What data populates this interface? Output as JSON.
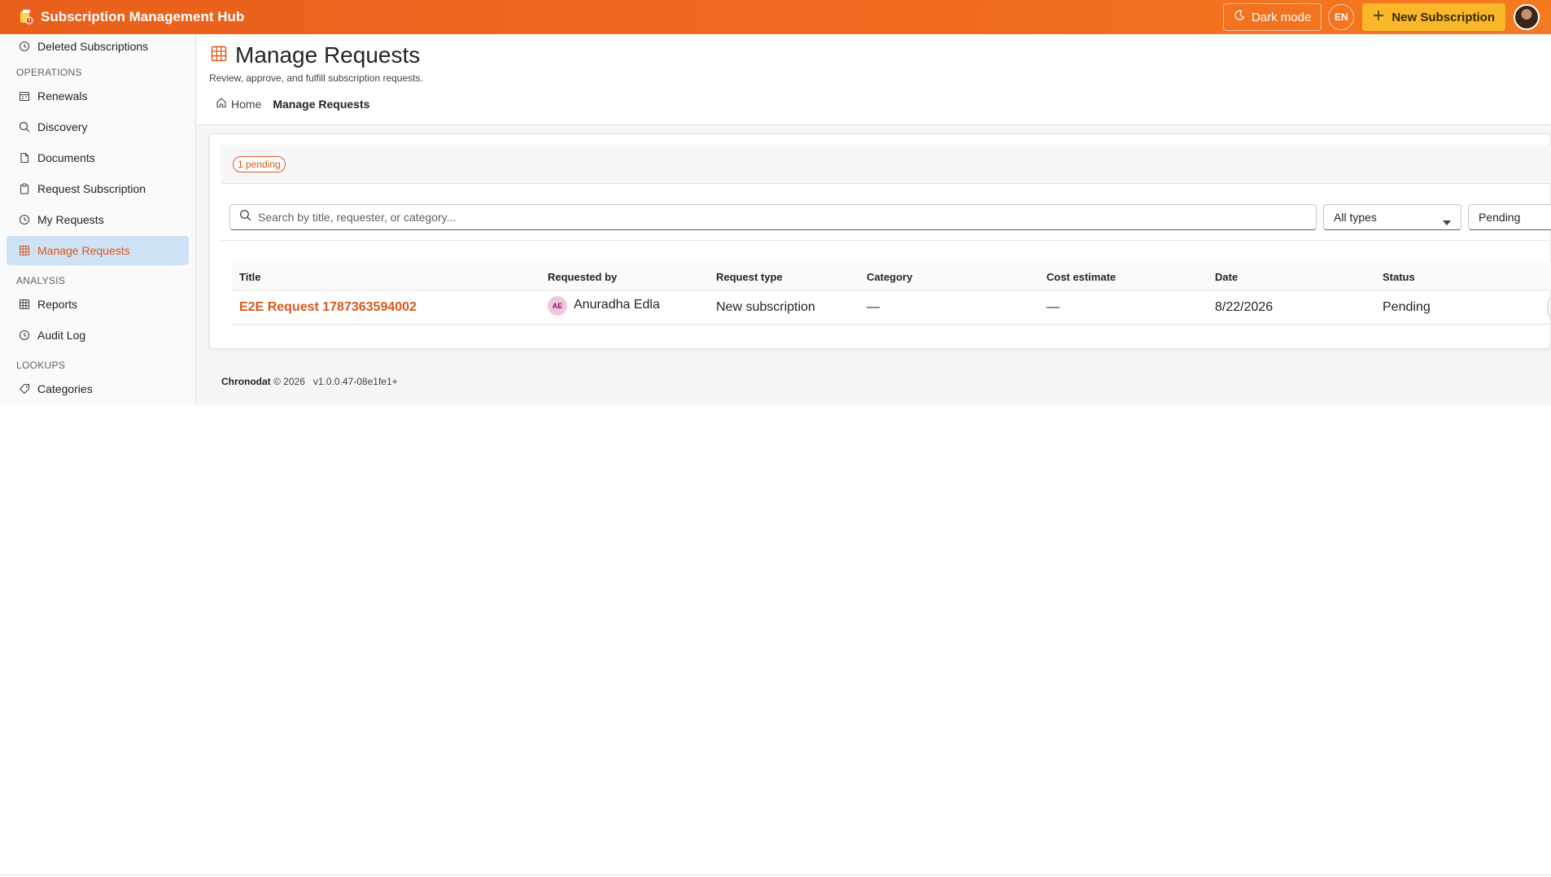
{
  "app": {
    "title": "Subscription Management Hub"
  },
  "topbar": {
    "dark_mode_label": "Dark mode",
    "language": "EN",
    "new_subscription_label": "New Subscription"
  },
  "sidebar": {
    "items_top": [
      {
        "label": "Deleted Subscriptions",
        "icon": "history-icon"
      }
    ],
    "sections": [
      {
        "label": "OPERATIONS"
      },
      {
        "label": "ANALYSIS"
      },
      {
        "label": "LOOKUPS"
      }
    ],
    "operations": [
      {
        "label": "Renewals",
        "icon": "calendar-icon"
      },
      {
        "label": "Discovery",
        "icon": "search-icon"
      },
      {
        "label": "Documents",
        "icon": "document-icon"
      },
      {
        "label": "Request Subscription",
        "icon": "clipboard-icon"
      },
      {
        "label": "My Requests",
        "icon": "history-icon"
      },
      {
        "label": "Manage Requests",
        "icon": "table-icon",
        "active": true
      }
    ],
    "analysis": [
      {
        "label": "Reports",
        "icon": "table-icon"
      },
      {
        "label": "Audit Log",
        "icon": "history-icon"
      }
    ],
    "lookups": [
      {
        "label": "Categories",
        "icon": "tag-icon"
      }
    ]
  },
  "page": {
    "title": "Manage Requests",
    "subtitle": "Review, approve, and fulfill subscription requests.",
    "breadcrumb": {
      "home": "Home",
      "current": "Manage Requests"
    }
  },
  "requests": {
    "pending_badge": "1 pending",
    "search_placeholder": "Search by title, requester, or category...",
    "type_filter": "All types",
    "status_filter": "Pending",
    "columns": {
      "title": "Title",
      "requested_by": "Requested by",
      "request_type": "Request type",
      "category": "Category",
      "cost_estimate": "Cost estimate",
      "date": "Date",
      "status": "Status"
    },
    "rows": [
      {
        "title": "E2E Request 1787363594002",
        "requester_initials": "AE",
        "requester": "Anuradha Edla",
        "request_type": "New subscription",
        "category": "—",
        "cost_estimate": "—",
        "date": "8/22/2026",
        "status": "Pending"
      }
    ]
  },
  "footer": {
    "brand": "Chronodat",
    "copyright": "© 2026",
    "version": "v1.0.0.47-08e1fe1+"
  },
  "colors": {
    "accent": "#d8581c",
    "topbar": "#f06a1e",
    "primary_button": "#f9b829",
    "active_nav_bg": "#cfe2f5"
  }
}
